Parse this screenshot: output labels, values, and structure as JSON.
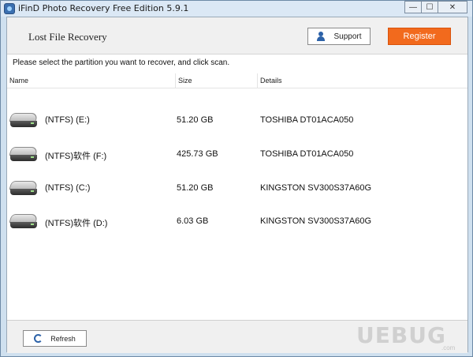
{
  "window": {
    "title": "iFinD Photo Recovery Free Edition 5.9.1",
    "minimize_label": "—",
    "maximize_label": "☐",
    "close_label": "✕"
  },
  "header": {
    "heading": "Lost File Recovery",
    "support_label": "Support",
    "register_label": "Register",
    "register_color": "#f26a1d",
    "accent_icon_color": "#2d62a8"
  },
  "main": {
    "instruction": "Please select the partition you want to recover, and click scan.",
    "columns": [
      "Name",
      "Size",
      "Details"
    ],
    "partitions": [
      {
        "name": "(NTFS) (E:)",
        "size": "51.20 GB",
        "details": "TOSHIBA DT01ACA050"
      },
      {
        "name": "(NTFS)软件 (F:)",
        "size": "425.73 GB",
        "details": "TOSHIBA DT01ACA050"
      },
      {
        "name": "(NTFS) (C:)",
        "size": "51.20 GB",
        "details": "KINGSTON SV300S37A60G"
      },
      {
        "name": "(NTFS)软件 (D:)",
        "size": "6.03 GB",
        "details": "KINGSTON SV300S37A60G"
      }
    ]
  },
  "footer": {
    "refresh_label": "Refresh"
  },
  "watermark": {
    "text": "UEBUG",
    "sub": ".com"
  }
}
